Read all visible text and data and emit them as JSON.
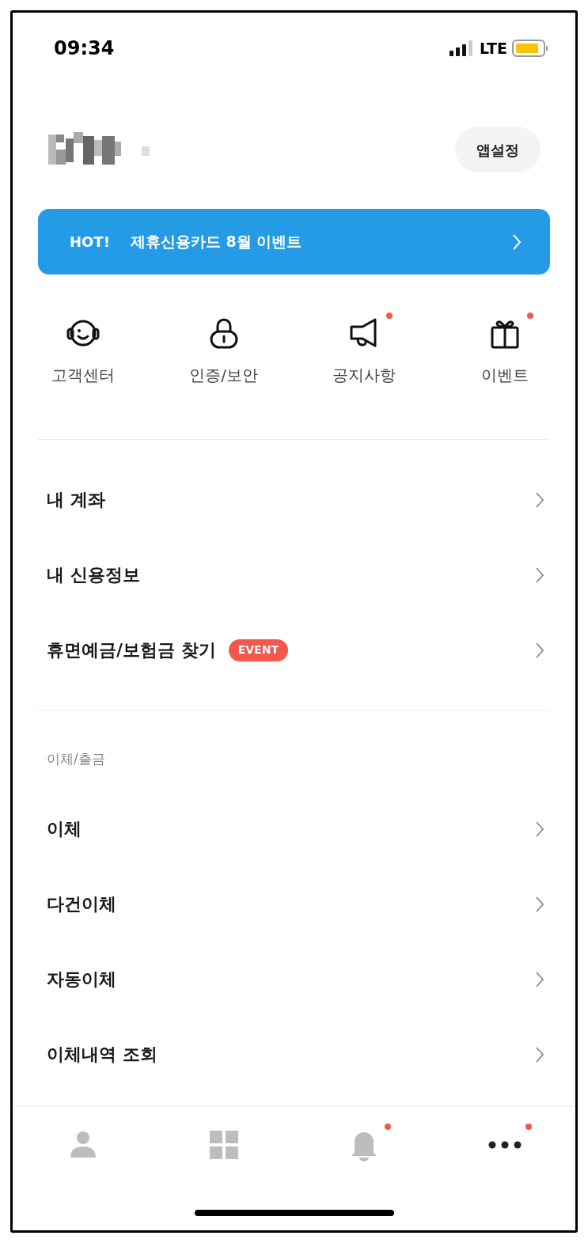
{
  "status_bar": {
    "time": "09:34",
    "network": "LTE"
  },
  "header": {
    "settings_button": "앱설정"
  },
  "banner": {
    "tag": "HOT!",
    "text": "제휴신용카드 8월 이벤트"
  },
  "quick_actions": [
    {
      "kind": "headset",
      "label": "고객센터",
      "badge": false
    },
    {
      "kind": "lock",
      "label": "인증/보안",
      "badge": false
    },
    {
      "kind": "megaphone",
      "label": "공지사항",
      "badge": true
    },
    {
      "kind": "gift",
      "label": "이벤트",
      "badge": true
    }
  ],
  "menu": [
    {
      "label": "내 계좌"
    },
    {
      "label": "내 신용정보"
    },
    {
      "label": "휴면예금/보험금 찾기",
      "tag": "EVENT"
    }
  ],
  "transfer_section": {
    "title": "이체/출금",
    "items": [
      {
        "label": "이체"
      },
      {
        "label": "다건이체"
      },
      {
        "label": "자동이체"
      },
      {
        "label": "이체내역 조회"
      }
    ]
  },
  "tab_bar": [
    {
      "kind": "person",
      "selected": false,
      "badge": false
    },
    {
      "kind": "grid",
      "selected": false,
      "badge": false
    },
    {
      "kind": "bell",
      "selected": false,
      "badge": true
    },
    {
      "kind": "more",
      "selected": true,
      "badge": true
    }
  ]
}
